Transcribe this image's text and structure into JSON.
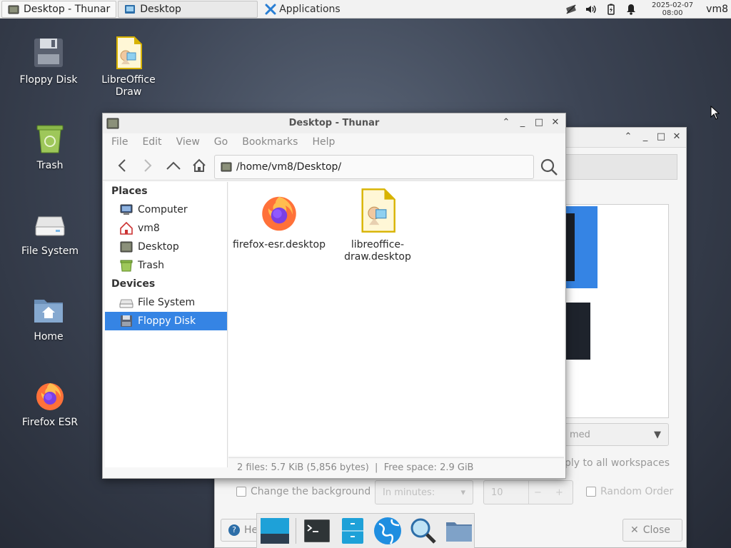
{
  "panel": {
    "tasks": [
      {
        "label": "Desktop - Thunar",
        "icon": "folder-window-icon"
      },
      {
        "label": "Desktop",
        "icon": "settings-window-icon"
      }
    ],
    "applications_label": "Applications",
    "clock_date": "2025-02-07",
    "clock_time": "08:00",
    "user": "vm8"
  },
  "desktop_icons": [
    {
      "label": "Floppy Disk",
      "icon": "floppy-disk-icon"
    },
    {
      "label": "LibreOffice Draw",
      "icon": "libreoffice-draw-icon"
    },
    {
      "label": "Trash",
      "icon": "trash-icon"
    },
    {
      "label": "File System",
      "icon": "drive-icon"
    },
    {
      "label": "Home",
      "icon": "home-folder-icon"
    },
    {
      "label": "Firefox ESR",
      "icon": "firefox-icon"
    }
  ],
  "thunar": {
    "title": "Desktop - Thunar",
    "menu": [
      "File",
      "Edit",
      "View",
      "Go",
      "Bookmarks",
      "Help"
    ],
    "location": "/home/vm8/Desktop/",
    "sidebar": {
      "places_heading": "Places",
      "places": [
        "Computer",
        "vm8",
        "Desktop",
        "Trash"
      ],
      "devices_heading": "Devices",
      "devices": [
        "File System",
        "Floppy Disk"
      ],
      "selected": "Floppy Disk"
    },
    "files": [
      {
        "name": "firefox-esr.desktop",
        "icon": "firefox-icon"
      },
      {
        "name": "libreoffice-draw.desktop",
        "icon": "libreoffice-draw-icon"
      }
    ],
    "status": "2 files: 5.7 KiB (5,856 bytes)  |  Free space: 2.9 GiB"
  },
  "background_window": {
    "style_partial": "med",
    "apply_all_partial": "ply to all workspaces",
    "change_background_label": "Change the background",
    "interval_placeholder": "In minutes:",
    "interval_value": "10",
    "random_order_label": "Random Order",
    "help_partial": "He",
    "close_label": "Close"
  },
  "colors": {
    "selection": "#3584e4",
    "panel": "#f2f2f2"
  }
}
